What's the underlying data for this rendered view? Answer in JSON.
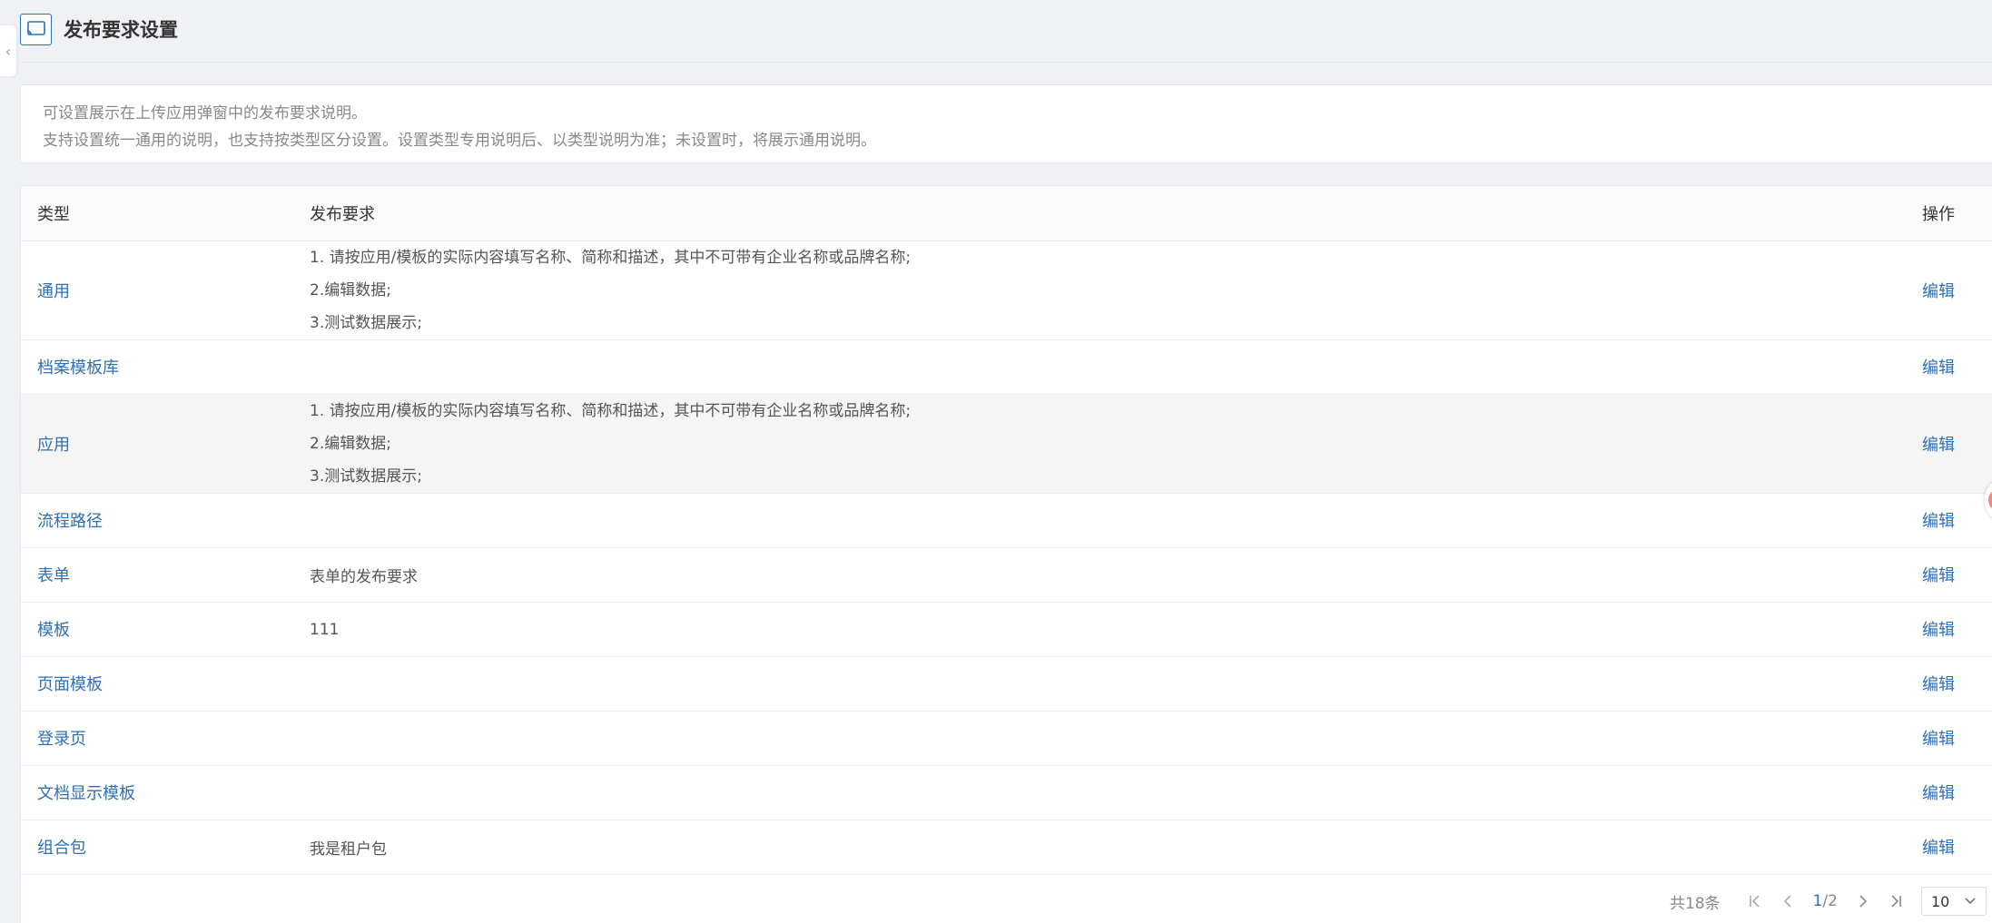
{
  "header": {
    "title": "发布要求设置",
    "icon": "cast-icon",
    "accent": "#2f6fb5"
  },
  "notice": {
    "line1": "可设置展示在上传应用弹窗中的发布要求说明。",
    "line2": "支持设置统一通用的说明，也支持按类型区分设置。设置类型专用说明后、以类型说明为准；未设置时，将展示通用说明。"
  },
  "table": {
    "columns": {
      "type": "类型",
      "requirement": "发布要求",
      "action": "操作"
    },
    "edit_label": "编辑",
    "rows": [
      {
        "type": "通用",
        "requirement_lines": [
          "1. 请按应用/模板的实际内容填写名称、简称和描述，其中不可带有企业名称或品牌名称;",
          "2.编辑数据;",
          "3.测试数据展示;"
        ]
      },
      {
        "type": "档案模板库",
        "requirement": ""
      },
      {
        "type": "应用",
        "requirement_lines": [
          "1. 请按应用/模板的实际内容填写名称、简称和描述，其中不可带有企业名称或品牌名称;",
          "2.编辑数据;",
          "3.测试数据展示;"
        ]
      },
      {
        "type": "流程路径",
        "requirement": ""
      },
      {
        "type": "表单",
        "requirement": "表单的发布要求"
      },
      {
        "type": "模板",
        "requirement": "111"
      },
      {
        "type": "页面模板",
        "requirement": ""
      },
      {
        "type": "登录页",
        "requirement": ""
      },
      {
        "type": "文档显示模板",
        "requirement": ""
      },
      {
        "type": "组合包",
        "requirement": "我是租户包"
      }
    ]
  },
  "pagination": {
    "total": "共18条",
    "current": "1",
    "separator": "/",
    "pages": "2",
    "page_size": "10"
  }
}
